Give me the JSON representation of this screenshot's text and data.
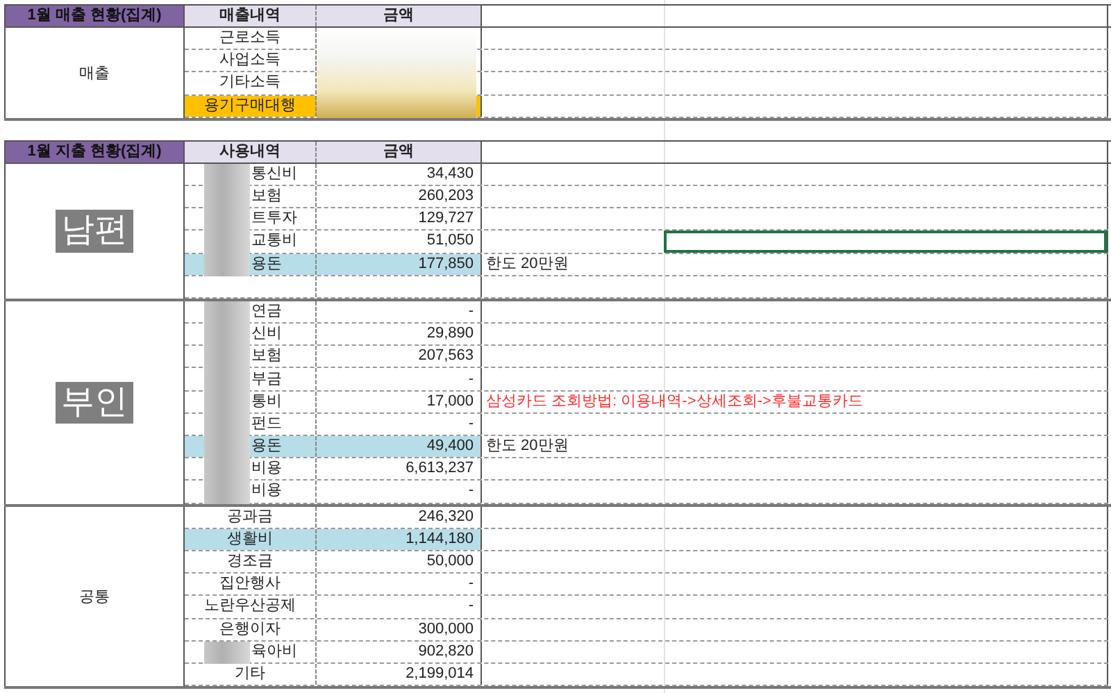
{
  "revenue": {
    "title": "1월 매출 현황(집계)",
    "headers": [
      "매출내역",
      "금액"
    ],
    "group": "매출",
    "amounts_blurred": true,
    "rows": [
      {
        "item": "근로소득",
        "color": "#ffffff"
      },
      {
        "item": "사업소득",
        "color": "#ffffff"
      },
      {
        "item": "기타소득",
        "color": "#ffffff"
      },
      {
        "item": "용기구매대행",
        "color": "#ffc000"
      }
    ]
  },
  "expense": {
    "title": "1월 지출 현황(집계)",
    "headers": [
      "사용내역",
      "금액"
    ],
    "groups": [
      {
        "label": "남편",
        "kind": "badge",
        "trailing_blank": true,
        "rows": [
          {
            "item": "통신비",
            "amount": "34,430",
            "blurred": true,
            "color": "#ffffff",
            "selected": false
          },
          {
            "item": "보험",
            "amount": "260,203",
            "blurred": true,
            "color": "#ffffff",
            "selected": false
          },
          {
            "item": "트투자",
            "amount": "129,727",
            "blurred": true,
            "color": "#ffffff",
            "selected": false
          },
          {
            "item": "교통비",
            "amount": "51,050",
            "blurred": true,
            "color": "#ffffff",
            "selected": true
          },
          {
            "item": "용돈",
            "amount": "177,850",
            "blurred": true,
            "color": "#b7dde8",
            "selected": false,
            "note": "한도 20만원",
            "note_alert": false
          }
        ]
      },
      {
        "label": "부인",
        "kind": "badge",
        "trailing_blank": false,
        "rows": [
          {
            "item": "연금",
            "amount": "-",
            "blurred": true,
            "color": "#ffffff",
            "selected": false
          },
          {
            "item": "신비",
            "amount": "29,890",
            "blurred": true,
            "color": "#ffffff",
            "selected": false
          },
          {
            "item": "보험",
            "amount": "207,563",
            "blurred": true,
            "color": "#ffffff",
            "selected": false
          },
          {
            "item": "부금",
            "amount": "-",
            "blurred": true,
            "color": "#ffffff",
            "selected": false
          },
          {
            "item": "통비",
            "amount": "17,000",
            "blurred": true,
            "color": "#ffffff",
            "selected": false,
            "note": "삼성카드 조회방법: 이용내역->상세조회->후불교통카드",
            "note_alert": true
          },
          {
            "item": "펀드",
            "amount": "-",
            "blurred": true,
            "color": "#ffffff",
            "selected": false
          },
          {
            "item": "용돈",
            "amount": "49,400",
            "blurred": true,
            "color": "#b7dde8",
            "selected": false,
            "note": "한도 20만원",
            "note_alert": false
          },
          {
            "item": "비용",
            "amount": "6,613,237",
            "blurred": true,
            "color": "#ffffff",
            "selected": false
          },
          {
            "item": "비용",
            "amount": "-",
            "blurred": true,
            "color": "#ffffff",
            "selected": false
          }
        ]
      },
      {
        "label": "공통",
        "kind": "plain",
        "trailing_blank": false,
        "rows": [
          {
            "item": "공과금",
            "amount": "246,320",
            "blurred": false,
            "color": "#ffffff",
            "selected": false
          },
          {
            "item": "생활비",
            "amount": "1,144,180",
            "blurred": false,
            "color": "#b7dde8",
            "selected": false
          },
          {
            "item": "경조금",
            "amount": "50,000",
            "blurred": false,
            "color": "#ffffff",
            "selected": false
          },
          {
            "item": "집안행사",
            "amount": "-",
            "blurred": false,
            "color": "#ffffff",
            "selected": false
          },
          {
            "item": "노란우산공제",
            "amount": "-",
            "blurred": false,
            "color": "#ffffff",
            "selected": false
          },
          {
            "item": "은행이자",
            "amount": "300,000",
            "blurred": false,
            "color": "#ffffff",
            "selected": false
          },
          {
            "item": "육아비",
            "amount": "902,820",
            "blurred": true,
            "color": "#ffffff",
            "selected": false
          },
          {
            "item": "기타",
            "amount": "2,199,014",
            "blurred": false,
            "color": "#ffffff",
            "selected": false
          }
        ]
      }
    ]
  }
}
